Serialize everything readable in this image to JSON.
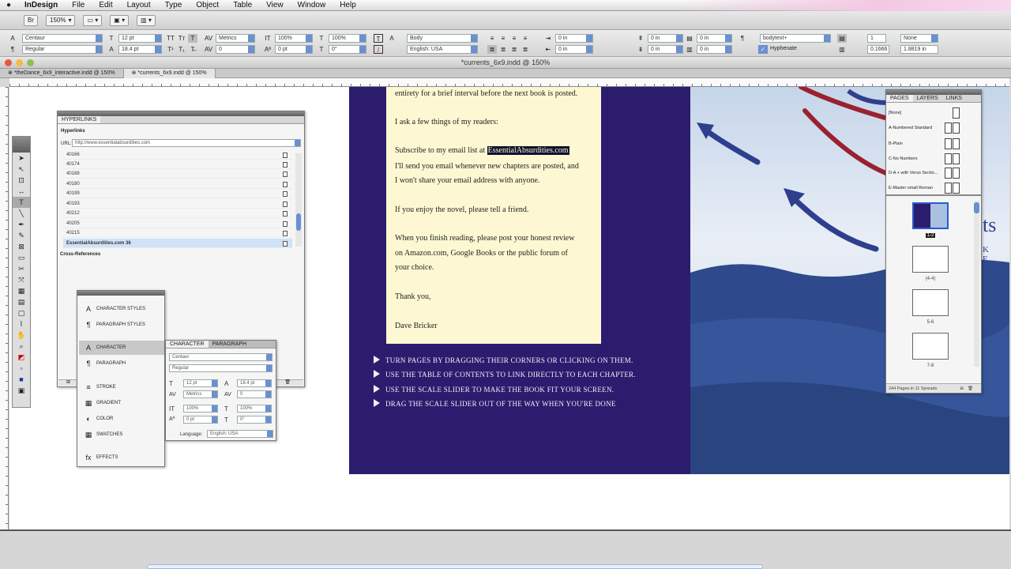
{
  "menubar": {
    "app_name": "InDesign",
    "items": [
      "File",
      "Edit",
      "Layout",
      "Type",
      "Object",
      "Table",
      "View",
      "Window",
      "Help"
    ]
  },
  "appbar": {
    "zoom": "150%"
  },
  "control_panel": {
    "font_family": "Centaur",
    "font_style": "Regular",
    "font_size": "12 pt",
    "leading": "18.4 pt",
    "kerning": "Metrics",
    "tracking": "0",
    "v_scale": "100%",
    "h_scale": "100%",
    "baseline": "0 pt",
    "skew": "0°",
    "char_style": "[None]",
    "paragraph_style": "Body",
    "language": "English: USA",
    "indent_left": "0 in",
    "indent_right": "0 in",
    "space_before": "0 in",
    "space_after": "0 in",
    "para_style2": "bodytext+",
    "hyphenate_label": "Hyphenate",
    "columns": "1",
    "col_none": "None",
    "val_a": "0.1666 in",
    "val_b": "1.8819 in"
  },
  "window": {
    "title": "*currents_6x9.indd @ 150%"
  },
  "doc_tabs": [
    {
      "label": "*theDance_6x9_interactive.indd @ 150%"
    },
    {
      "label": "*currents_6x9.indd @ 150%"
    }
  ],
  "page_text": {
    "p1": "entirety for a brief interval before the next book is posted.",
    "p2": "I ask a few things of my readers:",
    "p3_pre": "Subscribe to my email list at ",
    "p3_link": "EssentialAbsurdities.com",
    "p3_line2": "I'll send you email whenever new chapters are posted, and",
    "p3_line3": "I won't share your email address with anyone.",
    "p4": "If you enjoy the novel, please tell a friend.",
    "p5_line1": "When you finish reading, please post your honest review",
    "p5_line2": "on Amazon.com, Google Books or the public forum of",
    "p5_line3": "your choice.",
    "p6": "Thank you,",
    "p7": "Dave Bricker"
  },
  "bullets": [
    "TURN PAGES BY DRAGGING THEIR CORNERS OR CLICKING ON THEM.",
    "USE THE TABLE OF CONTENTS TO LINK DIRECTLY TO EACH CHAPTER.",
    "USE THE SCALE SLIDER TO MAKE THE BOOK FIT YOUR SCREEN.",
    "DRAG THE SCALE SLIDER OUT OF THE WAY WHEN YOU'RE DONE"
  ],
  "right_page": {
    "title_fragment": "ts",
    "subtitle_fragment": "K E"
  },
  "hyperlinks_panel": {
    "tab": "HYPERLINKS",
    "section_label": "Hyperlinks",
    "url_label": "URL:",
    "url": "http://www.essentialabsurdities.com",
    "rows": [
      "40166",
      "40174",
      "40168",
      "40180",
      "40199",
      "40193",
      "40212",
      "40205",
      "40215"
    ],
    "selected_row": "EssentialAbsurdities.com 36",
    "cross_refs_label": "Cross-References"
  },
  "styles_panel": {
    "items": [
      {
        "label": "CHARACTER STYLES",
        "icon": "A"
      },
      {
        "label": "PARAGRAPH STYLES",
        "icon": "¶"
      },
      {
        "label": "CHARACTER",
        "icon": "A"
      },
      {
        "label": "PARAGRAPH",
        "icon": "¶"
      },
      {
        "label": "STROKE",
        "icon": "≡"
      },
      {
        "label": "GRADIENT",
        "icon": "▦"
      },
      {
        "label": "COLOR",
        "icon": "◐"
      },
      {
        "label": "SWATCHES",
        "icon": "▦"
      },
      {
        "label": "EFFECTS",
        "icon": "fx"
      }
    ]
  },
  "character_panel": {
    "tab1": "CHARACTER",
    "tab2": "PARAGRAPH",
    "font": "Centaur",
    "style": "Regular",
    "size": "12 pt",
    "leading": "18.4 pt",
    "kerning": "Metrics",
    "tracking": "0",
    "v_scale": "100%",
    "h_scale": "100%",
    "baseline": "0 pt",
    "skew": "0°",
    "language_label": "Language:",
    "language": "English: USA"
  },
  "pages_panel": {
    "tabs": [
      "PAGES",
      "LAYERS",
      "LINKS"
    ],
    "masters": [
      "[None]",
      "A-Numbered Standard",
      "B-Plain",
      "C-No Numbers",
      "D-A + with Verso Sectio...",
      "E-Master small Roman"
    ],
    "page_labels": [
      "1-2",
      "(4-4)",
      "5-6",
      "7-8"
    ],
    "footer": "244 Pages in 11 Spreads"
  }
}
